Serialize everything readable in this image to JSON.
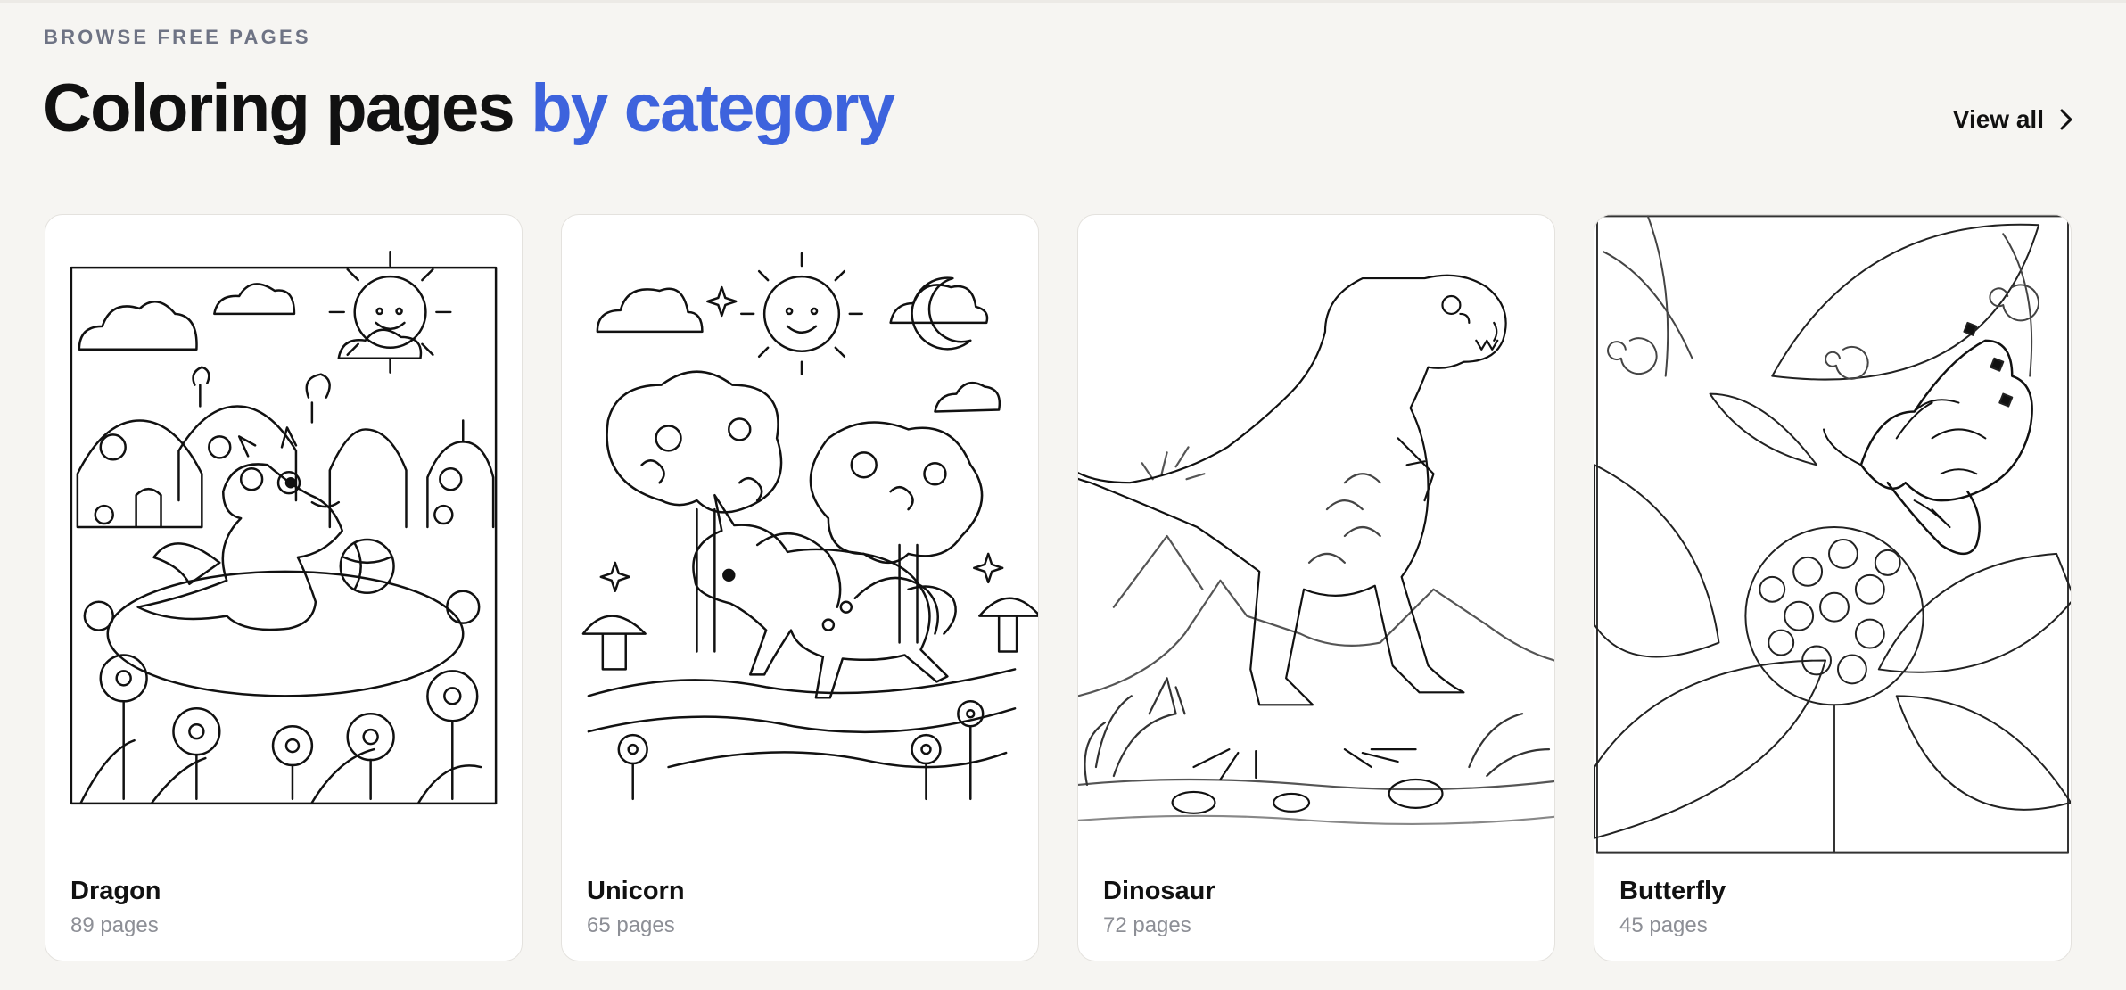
{
  "section": {
    "eyebrow": "BROWSE FREE PAGES",
    "title_main": "Coloring pages ",
    "title_accent": "by category",
    "view_all_label": "View all",
    "accent_color": "#3d63dd"
  },
  "categories": [
    {
      "name": "Dragon",
      "count": "89 pages",
      "icon": "dragon-illustration"
    },
    {
      "name": "Unicorn",
      "count": "65 pages",
      "icon": "unicorn-illustration"
    },
    {
      "name": "Dinosaur",
      "count": "72 pages",
      "icon": "dinosaur-illustration"
    },
    {
      "name": "Butterfly",
      "count": "45 pages",
      "icon": "butterfly-illustration"
    }
  ]
}
